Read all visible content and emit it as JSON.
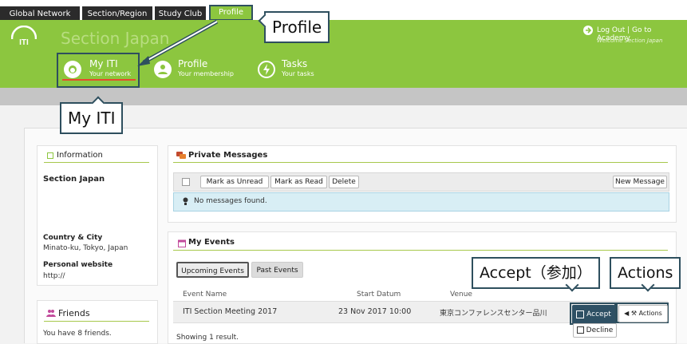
{
  "global_tabs": [
    {
      "label": "Global Network"
    },
    {
      "label": "Section/Region"
    },
    {
      "label": "Study Club"
    },
    {
      "label": "Profile"
    }
  ],
  "header": {
    "section_title": "Section Japan",
    "logo_text": "ITI",
    "user_links": "Log Out | Go to Academy",
    "welcome": "Welcome Section Japan"
  },
  "nav": [
    {
      "label": "My ITI",
      "sub": "Your network",
      "icon": "user-circle-icon"
    },
    {
      "label": "Profile",
      "sub": "Your membership",
      "icon": "person-icon"
    },
    {
      "label": "Tasks",
      "sub": "Your tasks",
      "icon": "bolt-icon"
    }
  ],
  "callouts": {
    "profile": "Profile",
    "myiti": "My ITI",
    "accept": "Accept（参加）",
    "actions": "Actions"
  },
  "sidebar": {
    "info_title": "Information",
    "section_name": "Section Japan",
    "country_label": "Country & City",
    "country_value": "Minato-ku, Tokyo, Japan",
    "website_label": "Personal website",
    "website_value": "http://",
    "friends_title": "Friends",
    "friends_text": "You have 8 friends."
  },
  "messages": {
    "title": "Private Messages",
    "mark_unread": "Mark as Unread",
    "mark_read": "Mark as Read",
    "delete": "Delete",
    "new_message": "New Message",
    "empty": "No messages found."
  },
  "events": {
    "title": "My Events",
    "tab_upcoming": "Upcoming Events",
    "tab_past": "Past Events",
    "columns": [
      "Event Name",
      "Start Datum",
      "Venue"
    ],
    "rows": [
      {
        "name": "ITI Section Meeting 2017",
        "start": "23 Nov 2017 10:00",
        "venue": "東京コンファレンスセンター品川"
      }
    ],
    "accept": "Accept",
    "decline": "Decline",
    "actions": "Actions",
    "footer": "Showing 1 result."
  },
  "colors": {
    "brand_green": "#8cc63f",
    "callout_border": "#2e4f5e",
    "info_blue": "#d8eef5"
  }
}
